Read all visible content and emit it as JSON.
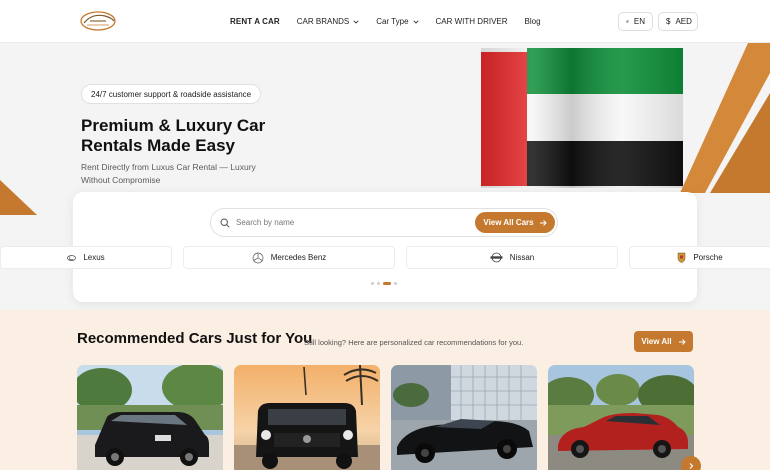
{
  "logo": {
    "alt": "Luxus Car Rental"
  },
  "nav": {
    "items": [
      {
        "label": "RENT A CAR",
        "active": true,
        "dropdown": false
      },
      {
        "label": "CAR BRANDS",
        "active": false,
        "dropdown": true
      },
      {
        "label": "Car Type",
        "active": false,
        "dropdown": true
      },
      {
        "label": "CAR WITH DRIVER",
        "active": false,
        "dropdown": false
      },
      {
        "label": "Blog",
        "active": false,
        "dropdown": false
      }
    ]
  },
  "header_controls": {
    "language": "EN",
    "currency": "AED",
    "language_icon": "globe-icon",
    "currency_icon": "dollar-icon"
  },
  "hero": {
    "badge": "24/7 customer support & roadside assistance",
    "title": "Premium & Luxury Car Rentals Made Easy",
    "subtitle": "Rent Directly from Luxus Car Rental — Luxury Without Compromise",
    "flag": "uae-flag"
  },
  "search": {
    "placeholder": "Search by name",
    "button_label": "View All Cars"
  },
  "brands": [
    {
      "name": "Lexus",
      "icon": "lexus-logo"
    },
    {
      "name": "Mercedes Benz",
      "icon": "mercedes-logo"
    },
    {
      "name": "Nissan",
      "icon": "nissan-logo"
    },
    {
      "name": "Porsche",
      "icon": "porsche-logo"
    }
  ],
  "carousel": {
    "pages": 4,
    "active_index": 2
  },
  "recommended": {
    "title": "Recommended Cars Just for You",
    "subtitle": "Still looking? Here are personalized car recommendations for you.",
    "view_all_label": "View All",
    "cars": [
      {
        "name": "black-suv-photo"
      },
      {
        "name": "black-g-wagon-photo"
      },
      {
        "name": "black-supercar-photo"
      },
      {
        "name": "red-muscle-car-photo"
      }
    ]
  },
  "colors": {
    "accent": "#c4792f",
    "hero_bg": "#f4f4f4",
    "reco_bg": "#fbeee3"
  }
}
